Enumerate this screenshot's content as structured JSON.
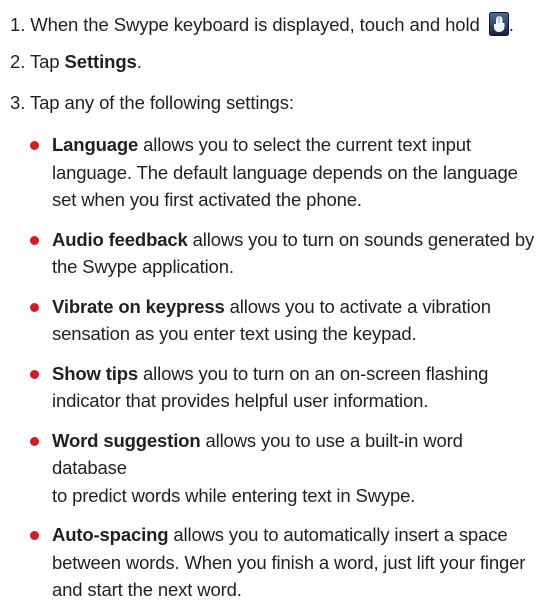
{
  "steps": [
    {
      "num": "1.",
      "text": "When the Swype keyboard is displayed, touch and hold",
      "after": "."
    },
    {
      "num": "2.",
      "pre": "Tap",
      "bold": "Settings",
      "post": "."
    },
    {
      "num": "3.",
      "text": "Tap any of the following settings:"
    }
  ],
  "icon": "swype-key-icon",
  "colors": {
    "bullet": "#d71a21",
    "text": "#231f20"
  },
  "settings": [
    {
      "term": "Language",
      "desc": "allows you to select the current text input",
      "desc2": "language. The default language depends on the language",
      "desc3": "set when you first activated the phone."
    },
    {
      "term": "Audio feedback",
      "desc": "allows you to turn on sounds generated by",
      "desc2": "the Swype application."
    },
    {
      "term": "Vibrate on keypress",
      "desc": "allows you to activate a vibration",
      "desc2": "sensation as you enter text using the keypad."
    },
    {
      "term": "Show tips",
      "desc": "allows you to turn on an on-screen flashing",
      "desc2": "indicator that provides helpful user information."
    },
    {
      "term": "Word suggestion",
      "desc": "allows you to use a built-in word database",
      "desc2": "to predict words while entering text in Swype."
    },
    {
      "term": "Auto-spacing",
      "desc": "allows you to automatically insert a space",
      "desc2": "between words. When you finish a word, just lift your finger",
      "desc3": "and start the next word."
    }
  ]
}
